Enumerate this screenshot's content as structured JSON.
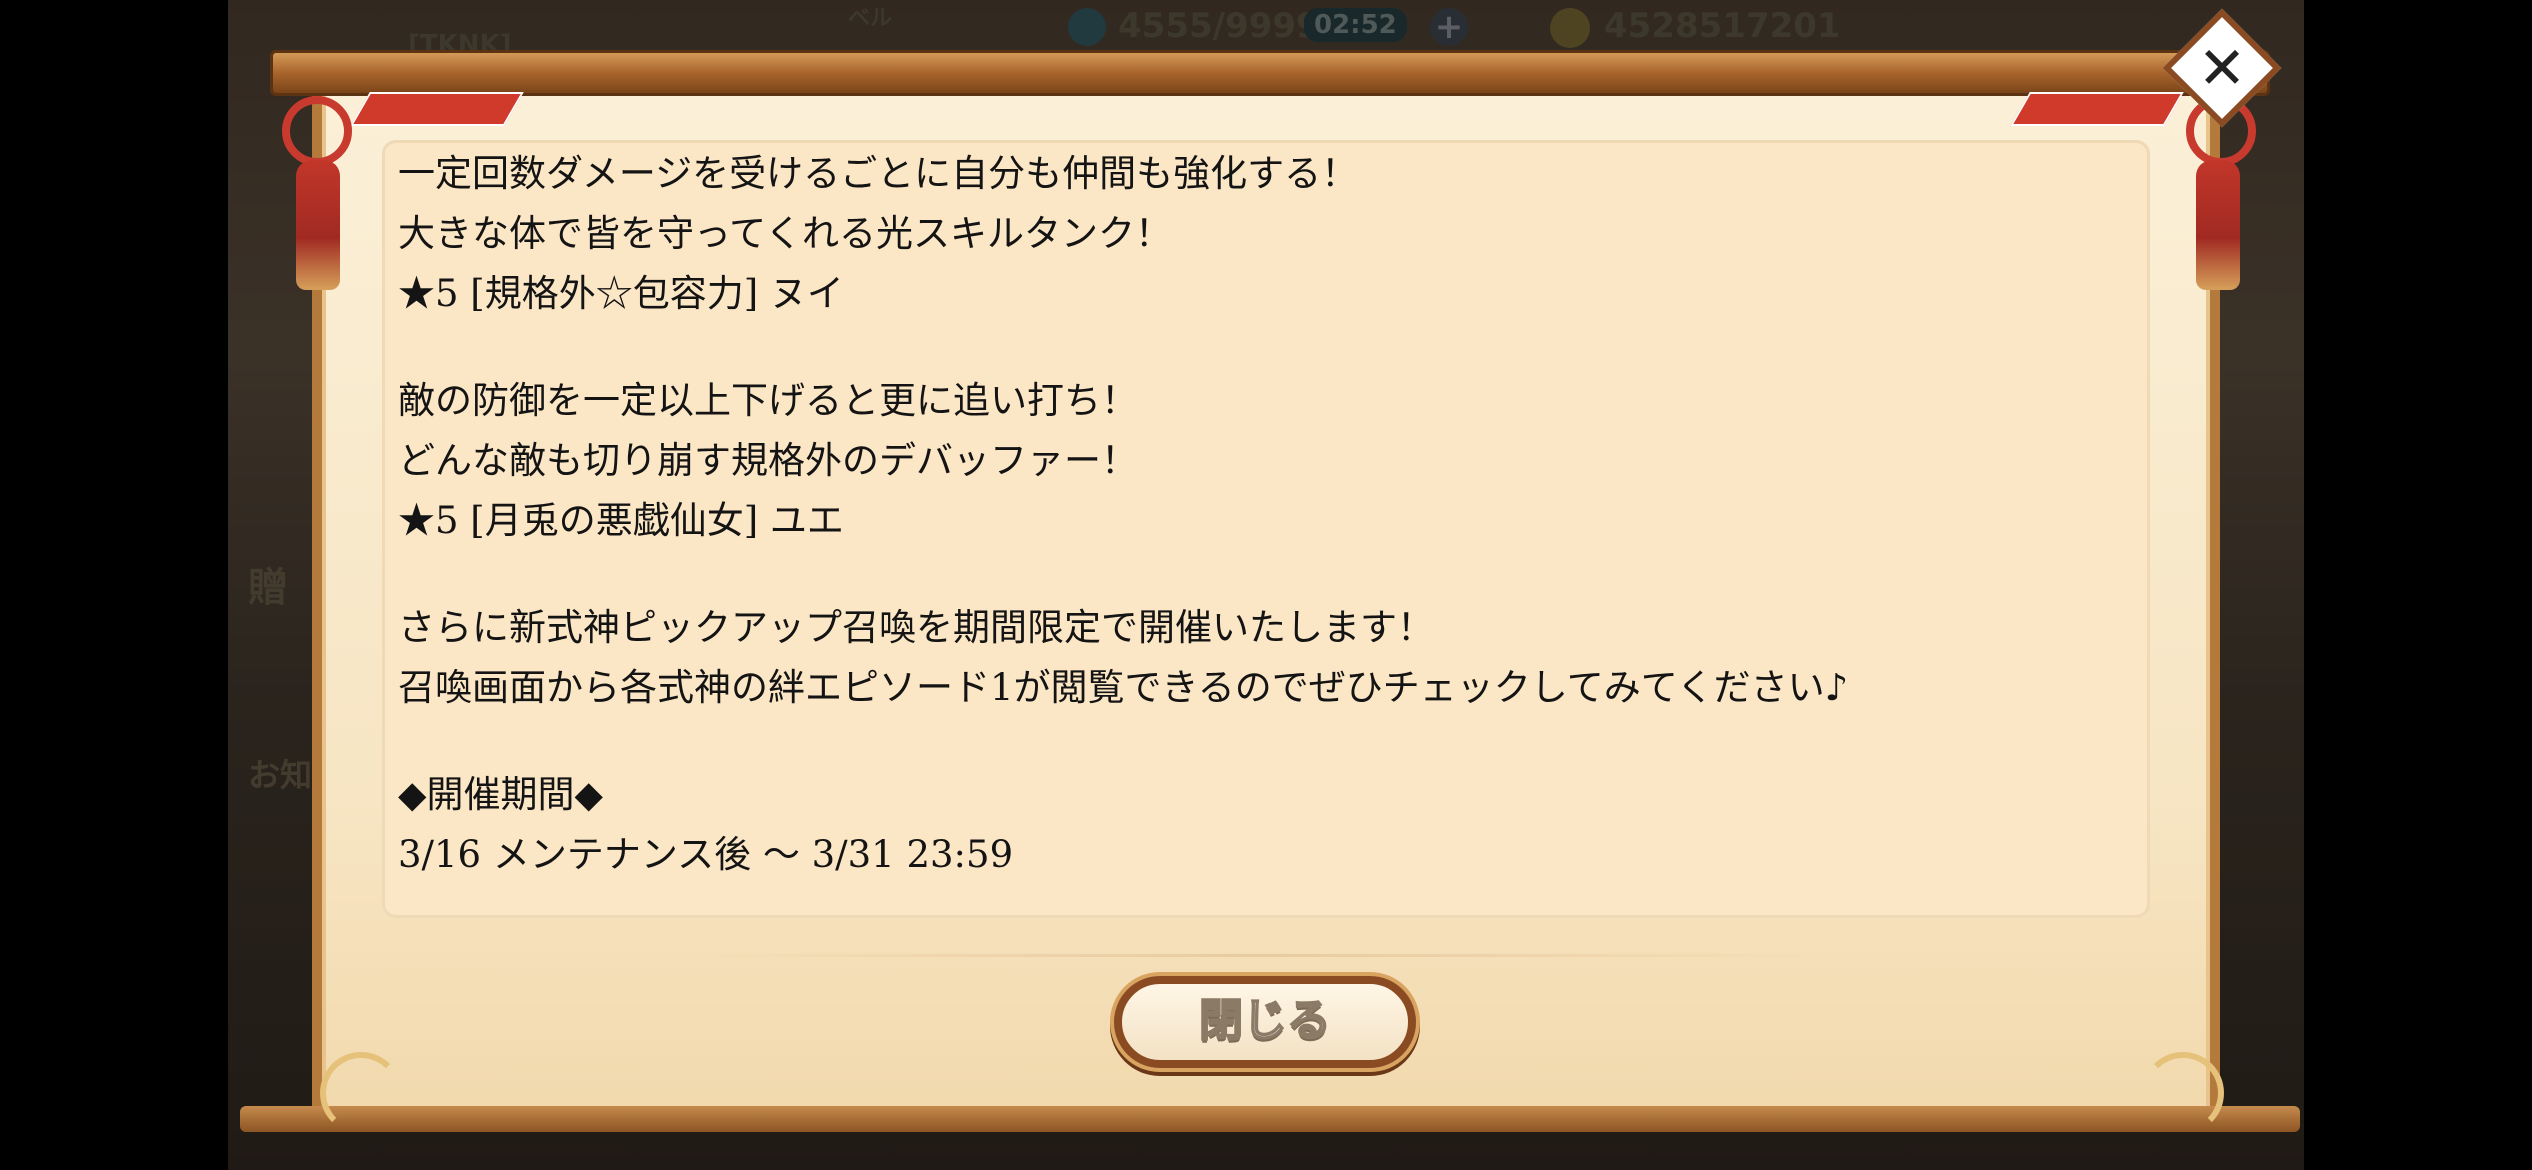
{
  "hud": {
    "player_name": "[TKNK]",
    "level_label": "ベル",
    "stamina": "4555/9999",
    "timer": "02:52",
    "coins": "4528517201"
  },
  "background": {
    "side_label_1": "贈",
    "side_label_2": "お知"
  },
  "dialog": {
    "lines": [
      "一定回数ダメージを受けるごとに自分も仲間も強化する！",
      "大きな体で皆を守ってくれる光スキルタンク！",
      "★5 [規格外☆包容力] ヌイ",
      "",
      "敵の防御を一定以上下げると更に追い打ち！",
      "どんな敵も切り崩す規格外のデバッファー！",
      "★5 [月兎の悪戯仙女] ユエ",
      "",
      "さらに新式神ピックアップ召喚を期間限定で開催いたします！",
      "召喚画面から各式神の絆エピソード1が閲覧できるのでぜひチェックしてみてください♪",
      "",
      "◆開催期間◆",
      "3/16 メンテナンス後 〜 3/31 23:59"
    ],
    "close_button_label": "閉じる",
    "close_icon": "close-icon"
  },
  "colors": {
    "frame": "#b37a3c",
    "panel": "#fbe6c6",
    "ribbon": "#d03a2a"
  }
}
